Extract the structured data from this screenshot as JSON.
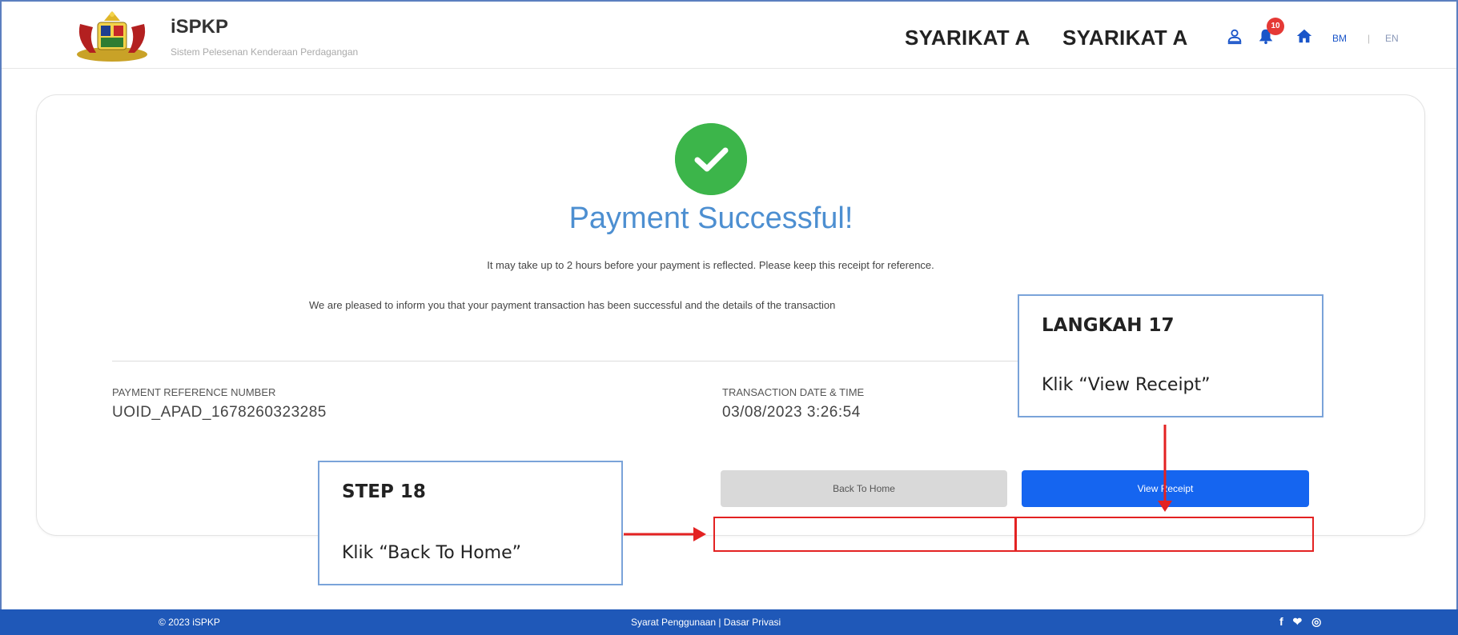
{
  "header": {
    "app_title": "iSPKP",
    "app_subtitle": "Sistem Pelesenan Kenderaan Perdagangan",
    "company_1": "SYARIKAT A",
    "company_2": "SYARIKAT A",
    "notification_count": "10",
    "lang_bm": "BM",
    "lang_separator": "|",
    "lang_en": "EN",
    "icons": [
      "user-icon",
      "bell-icon",
      "home-icon"
    ],
    "accent_color": "#1a55c9"
  },
  "main": {
    "status_title": "Payment Successful!",
    "message_1": "It may take up to 2 hours before your payment is reflected. Please keep this receipt for reference.",
    "message_2": "We are pleased to inform you that your payment transaction has been successful and the details of the transaction",
    "reference_label": "PAYMENT REFERENCE NUMBER",
    "reference_value": "UOID_APAD_1678260323285",
    "datetime_label": "TRANSACTION DATE & TIME",
    "datetime_value": "03/08/2023 3:26:54",
    "back_button": "Back To Home",
    "receipt_button": "View Receipt",
    "success_color": "#3cb54a",
    "title_color": "#4d8fd1"
  },
  "callouts": {
    "step17_title": "LANGKAH 17",
    "step17_text": "Klik “View Receipt”",
    "step18_title": "STEP 18",
    "step18_text": "Klik “Back To Home”",
    "highlight_color": "#e32222"
  },
  "footer": {
    "copyright": "© 2023 iSPKP",
    "links": "Syarat Penggunaan | Dasar Privasi",
    "social": "f ❤ ◎",
    "background": "#1f58b8"
  }
}
